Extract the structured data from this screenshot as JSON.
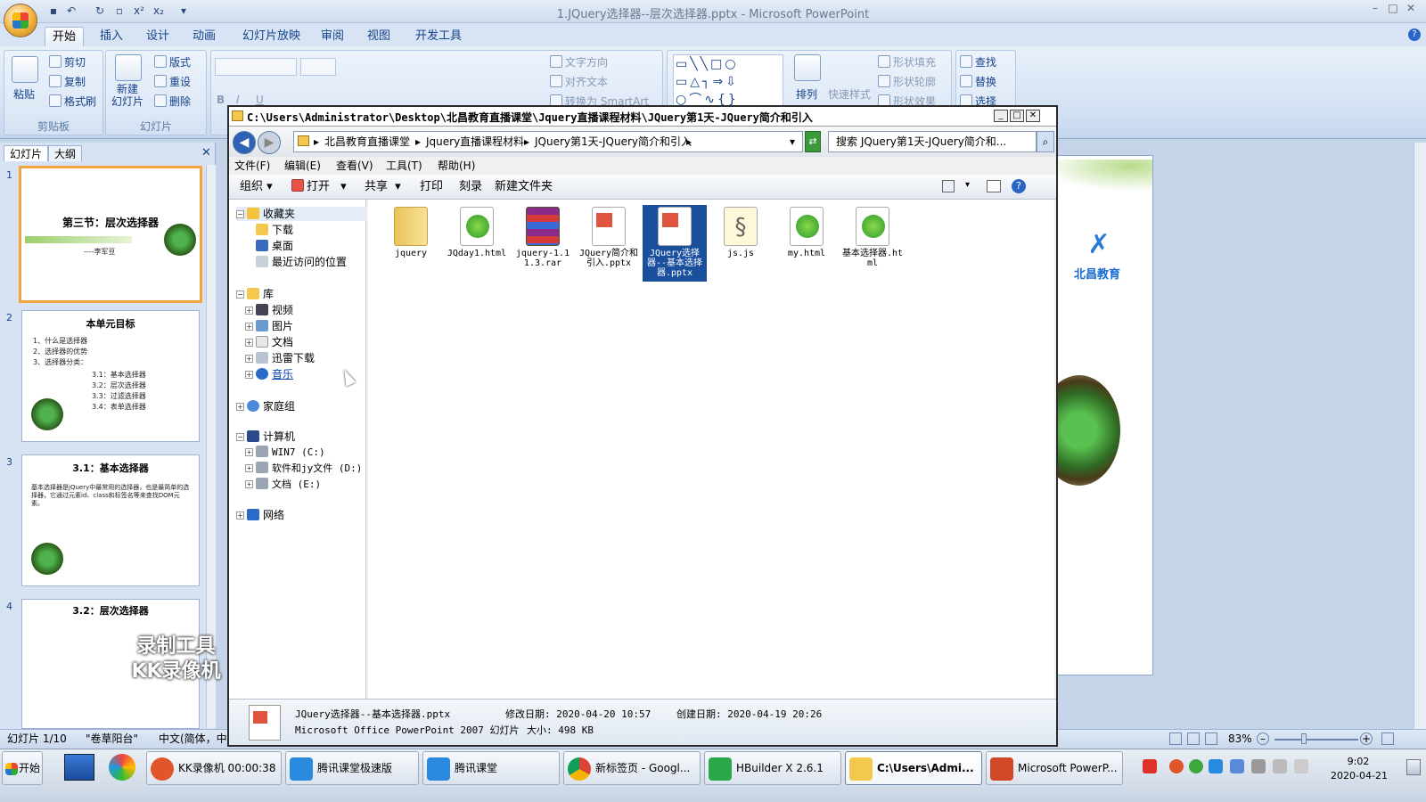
{
  "app": {
    "window_title": "1.JQuery选择器--层次选择器.pptx - Microsoft PowerPoint"
  },
  "ribbon": {
    "tabs": [
      "开始",
      "插入",
      "设计",
      "动画",
      "幻灯片放映",
      "审阅",
      "视图",
      "开发工具"
    ],
    "clipboard": {
      "paste": "粘贴",
      "cut": "剪切",
      "copy": "复制",
      "format_painter": "格式刷",
      "group": "剪贴板"
    },
    "slides": {
      "new_slide": "新建\n幻灯片",
      "layout": "版式",
      "reset": "重设",
      "delete": "删除",
      "group": "幻灯片"
    },
    "paragraph": {
      "text_direction": "文字方向",
      "align_text": "对齐文本",
      "convert_smartart": "转换为 SmartArt"
    },
    "drawing": {
      "arrange": "排列",
      "quick_styles": "快速样式",
      "shape_fill": "形状填充",
      "shape_outline": "形状轮廓",
      "shape_effects": "形状效果"
    },
    "editing": {
      "find": "查找",
      "replace": "替换",
      "select": "选择"
    }
  },
  "left_pane": {
    "tabs": [
      "幻灯片",
      "大纲"
    ],
    "slides": [
      {
        "num": "1",
        "title": "第三节：层次选择器",
        "body": "----李军豆"
      },
      {
        "num": "2",
        "title": "本单元目标",
        "body": [
          "1、什么是选择器",
          "2、选择器的优势",
          "3、选择器分类：",
          "3.1：基本选择器",
          "3.2：层次选择器",
          "3.3：过滤选择器",
          "3.4：表单选择器"
        ]
      },
      {
        "num": "3",
        "title": "3.1：基本选择器",
        "body": "基本选择器是jQuery中最常用的选择器，也是最简单的选择器，它通过元素id、class和标签名等来查找DOM元素。"
      },
      {
        "num": "4",
        "title": "3.2：层次选择器",
        "body": ""
      }
    ]
  },
  "slide_logo_text": "北昌教育",
  "watermark": {
    "line1": "录制工具",
    "line2": "KK录像机"
  },
  "statusbar": {
    "slide_info": "幻灯片 1/10",
    "theme": "\"卷草阳台\"",
    "language": "中文(简体，中",
    "zoom": "83%"
  },
  "explorer": {
    "title": "C:\\Users\\Administrator\\Desktop\\北昌教育直播课堂\\Jquery直播课程材料\\JQuery第1天-JQuery简介和引入",
    "address": [
      "北昌教育直播课堂",
      "Jquery直播课程材料",
      "JQuery第1天-JQuery简介和引入"
    ],
    "search_placeholder": "搜索 JQuery第1天-JQuery简介和...",
    "menu": [
      "文件(F)",
      "编辑(E)",
      "查看(V)",
      "工具(T)",
      "帮助(H)"
    ],
    "commands": [
      "组织",
      "打开",
      "共享",
      "打印",
      "刻录",
      "新建文件夹"
    ],
    "tree": {
      "favorites": "收藏夹",
      "downloads": "下载",
      "desktop": "桌面",
      "recent": "最近访问的位置",
      "libraries": "库",
      "videos": "视频",
      "pictures": "图片",
      "documents": "文档",
      "xunlei": "迅雷下载",
      "music": "音乐",
      "homegroup": "家庭组",
      "computer": "计算机",
      "drive_c": "WIN7 (C:)",
      "drive_d": "软件和jy文件 (D:)",
      "drive_e": "文档 (E:)",
      "network": "网络"
    },
    "files": [
      {
        "name": "jquery",
        "type": "folder"
      },
      {
        "name": "JQday1.html",
        "type": "html"
      },
      {
        "name": "jquery-1.11.3.rar",
        "type": "rar"
      },
      {
        "name": "JQuery简介和引入.pptx",
        "type": "pptx"
      },
      {
        "name": "JQuery选择器--基本选择器.pptx",
        "type": "pptx",
        "selected": true
      },
      {
        "name": "js.js",
        "type": "js"
      },
      {
        "name": "my.html",
        "type": "html"
      },
      {
        "name": "基本选择器.html",
        "type": "html"
      }
    ],
    "details": {
      "filename": "JQuery选择器--基本选择器.pptx",
      "filetype": "Microsoft Office PowerPoint 2007 幻灯片",
      "modified": "修改日期: 2020-04-20 10:57",
      "created": "创建日期: 2020-04-19 20:26",
      "size": "大小: 498 KB"
    }
  },
  "taskbar": {
    "start": "开始",
    "buttons": [
      "KK录像机 00:00:38",
      "腾讯课堂极速版",
      "腾讯课堂",
      "新标签页 - Googl...",
      "HBuilder X 2.6.1",
      "C:\\Users\\Admi...",
      "Microsoft PowerP..."
    ],
    "time": "9:02",
    "date": "2020-04-21"
  },
  "colors": {
    "accent": "#15428b",
    "selection": "#1a4f9e",
    "slide_selected": "#f2a53c"
  }
}
